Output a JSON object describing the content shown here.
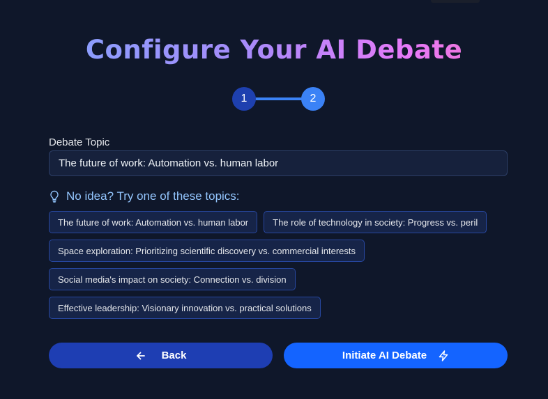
{
  "header": {
    "title": "Configure Your AI Debate"
  },
  "stepper": {
    "steps": [
      "1",
      "2"
    ],
    "current": 2
  },
  "topic": {
    "label": "Debate Topic",
    "value": "The future of work: Automation vs. human labor"
  },
  "suggestions": {
    "hint": "No idea? Try one of these topics:",
    "items": [
      "The future of work: Automation vs. human labor",
      "The role of technology in society: Progress vs. peril",
      "Space exploration: Prioritizing scientific discovery vs. commercial interests",
      "Social media's impact on society: Connection vs. division",
      "Effective leadership: Visionary innovation vs. practical solutions"
    ]
  },
  "actions": {
    "back_label": "Back",
    "start_label": "Initiate AI Debate",
    "back_icon": "arrow-left-icon",
    "start_icon": "lightning-icon"
  },
  "colors": {
    "background": "#0f172a",
    "accent": "#1464ff",
    "back_button": "#1e3eb3",
    "hint_text": "#93c5fd"
  }
}
